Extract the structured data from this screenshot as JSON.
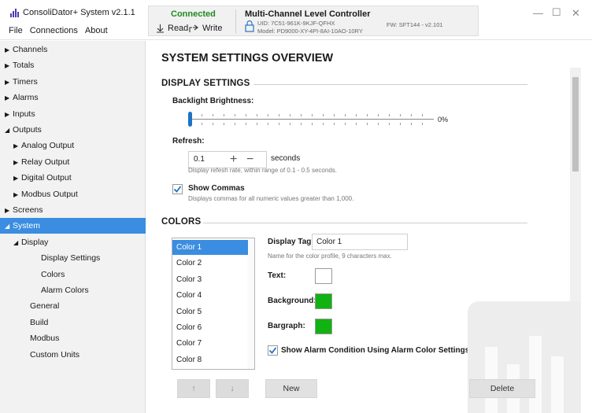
{
  "titlebar": {
    "app_title": "ConsoliDator+ System v2.1.1",
    "menu": [
      "File",
      "Connections",
      "About"
    ],
    "connection_status": "Connected",
    "read_label": "Read",
    "write_label": "Write",
    "controller_title": "Multi-Channel Level Controller",
    "uid": "UID: 7C51-961K-9KJF-QFHX",
    "model": "Model: PD9000-XY-4PI-8AI-10AO-10RY",
    "firmware": "FW: SFT144 - v2.101",
    "window_controls": [
      "minimize-icon",
      "maximize-icon",
      "close-icon"
    ]
  },
  "sidebar": {
    "items": [
      {
        "label": "Channels",
        "toggle": "▶",
        "level": 0
      },
      {
        "label": "Totals",
        "toggle": "▶",
        "level": 0
      },
      {
        "label": "Timers",
        "toggle": "▶",
        "level": 0
      },
      {
        "label": "Alarms",
        "toggle": "▶",
        "level": 0
      },
      {
        "label": "Inputs",
        "toggle": "▶",
        "level": 0
      },
      {
        "label": "Outputs",
        "toggle": "◢",
        "level": 0
      },
      {
        "label": "Analog Output",
        "toggle": "▶",
        "level": 1
      },
      {
        "label": "Relay Output",
        "toggle": "▶",
        "level": 1
      },
      {
        "label": "Digital Output",
        "toggle": "▶",
        "level": 1
      },
      {
        "label": "Modbus Output",
        "toggle": "▶",
        "level": 1
      },
      {
        "label": "Screens",
        "toggle": "▶",
        "level": 0
      },
      {
        "label": "System",
        "toggle": "◢",
        "level": 0,
        "selected": true
      },
      {
        "label": "Display",
        "toggle": "◢",
        "level": 1
      },
      {
        "label": "Display Settings",
        "toggle": "",
        "level": 2
      },
      {
        "label": "Colors",
        "toggle": "",
        "level": 2
      },
      {
        "label": "Alarm Colors",
        "toggle": "",
        "level": 2
      },
      {
        "label": "General",
        "toggle": "",
        "level": 1
      },
      {
        "label": "Build",
        "toggle": "",
        "level": 1
      },
      {
        "label": "Modbus",
        "toggle": "",
        "level": 1
      },
      {
        "label": "Custom Units",
        "toggle": "",
        "level": 1
      }
    ]
  },
  "main": {
    "page_title": "SYSTEM SETTINGS OVERVIEW",
    "display_settings": {
      "heading": "DISPLAY SETTINGS",
      "backlight_label": "Backlight Brightness:",
      "backlight_value": "0%",
      "backlight_fraction": 0,
      "refresh_label": "Refresh:",
      "refresh_value": "0.1",
      "refresh_unit": "seconds",
      "refresh_hint": "Display refesh rate, within range of 0.1 - 0.5 seconds.",
      "show_commas_label": "Show Commas",
      "show_commas_checked": true,
      "show_commas_hint": "Displays commas for all numeric values greater than 1,000."
    },
    "colors": {
      "heading": "COLORS",
      "profiles": [
        "Color 1",
        "Color 2",
        "Color 3",
        "Color 4",
        "Color 5",
        "Color 6",
        "Color 7",
        "Color 8"
      ],
      "selected_index": 0,
      "display_tag_label": "Display Tag:",
      "display_tag_value": "Color 1",
      "display_tag_hint": "Name for the color profile, 9 characters max.",
      "text_label": "Text:",
      "text_color": "#ffffff",
      "background_label": "Background:",
      "background_color": "#11b211",
      "bargraph_label": "Bargraph:",
      "bargraph_color": "#11b211",
      "alarm_condition_label": "Show Alarm Condition Using Alarm Color Settings.",
      "alarm_condition_checked": true
    },
    "buttons": {
      "move_up": "↑",
      "move_down": "↓",
      "new": "New",
      "delete": "Delete"
    }
  },
  "accent_color": "#3a8de0"
}
